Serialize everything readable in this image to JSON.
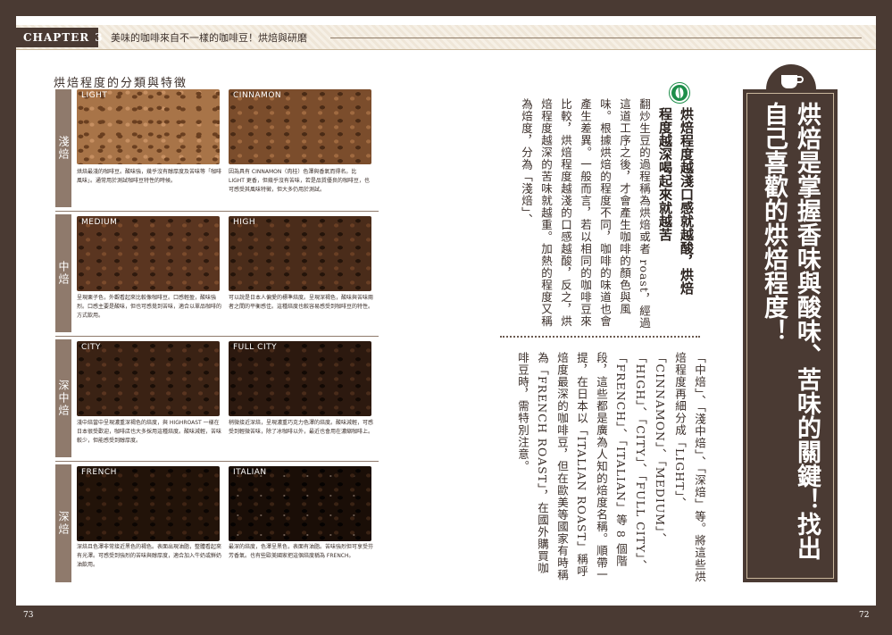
{
  "header": {
    "chapter_label": "CHAPTER",
    "chapter_number": "3",
    "chapter_title": "美味的咖啡來自不一樣的咖啡豆！烘焙與研磨"
  },
  "left_page": {
    "section_title": "烘焙程度的分類與特徵",
    "groups": [
      {
        "label": "淺焙"
      },
      {
        "label": "中焙"
      },
      {
        "label": "深中焙"
      },
      {
        "label": "深焙"
      }
    ],
    "roasts": [
      {
        "name": "LIGHT",
        "description": "烘焙最淺的咖啡豆。酸味強，幾乎沒有醇厚度及苦味等「咖啡風味」。通常用於測試咖啡豆特性的時候。"
      },
      {
        "name": "CINNAMON",
        "description": "因為具有 CINNAMON（肉桂）色澤與香氣而得名。比 LIGHT 更香，但幾乎沒有苦味，若是品質優良的咖啡豆，也可感受其風味特徵，但大多仍用於測試。"
      },
      {
        "name": "MEDIUM",
        "description": "呈現栗子色，外觀看起來比較像咖啡豆。口感輕盈，酸味強烈。口感主要是酸味，但也可感覺到苦味，適合以單品咖啡的方式飲用。"
      },
      {
        "name": "HIGH",
        "description": "可以說是日本人偏愛的標準焙度。呈現深褐色，酸味與苦味兩者之間的平衡感佳。這種焙度也較容易感受到咖啡豆的特性。"
      },
      {
        "name": "CITY",
        "description": "淺中焙當中呈現濃重深褐色的焙度，與 HIGHROAST 一樣在日本很受歡迎，咖啡店也大多採用這種焙度。酸味減輕，苦味較少，但能感受到醇厚度。"
      },
      {
        "name": "FULL CITY",
        "description": "稍微接近深焙，呈現濃重巧克力色澤的焙度。酸味減輕，可感受到輕微苦味，除了冰咖啡以外，最近也會用在濃縮咖啡上。"
      },
      {
        "name": "FRENCH",
        "description": "深焙且色澤非常接近黑色的褐色。表面出現油脂，整體看起來有光澤。可感受到強烈的苦味與醇厚度，適合加入牛奶或鮮奶油飲用。"
      },
      {
        "name": "ITALIAN",
        "description": "最深的焙度，色澤呈黑色，表面有油脂。苦味強烈但可享受芬芳香氣。也有些歐美國家把這個焙度稱為 FRENCH。"
      }
    ],
    "page_number": "73"
  },
  "right_page": {
    "main_title": "烘焙是掌握香味與酸味、苦味的關鍵！找出自己喜歡的烘焙程度！",
    "sub_title": "烘焙程度越淺口感就越酸，烘焙程度越深喝起來就越苦",
    "paragraph_1": "翻炒生豆的過程稱為烘焙或者 roast，經過這道工序之後，才會產生咖啡的顏色與風味。根據烘焙的程度不同，咖啡的味道也會產生差異。一般而言，若以相同的咖啡豆來比較，烘焙程度越淺的口感越酸，反之，烘焙程度越深的苦味就越重。加熱的程度又稱為焙度，分為「淺焙」、",
    "paragraph_2": "「中焙」、「淺中焙」、「深焙」等。將這些烘焙程度再細分成「LIGHT」、「CINNAMON」、「MEDIUM」、「HIGH」、「CITY」、「FULL CITY」、「FRENCH」、「ITALIAN」等 8 個階段，這些都是廣為人知的焙度名稱。順帶一提，在日本以「ITALIAN ROAST」稱呼焙度最深的咖啡豆，但在歐美等國家有時稱為「FRENCH ROAST」，在國外購買咖啡豆時，需特別注意。",
    "page_number": "72"
  },
  "colors": {
    "frame": "#4a3a33",
    "side_tab": "#8f7a6c",
    "accent_green": "#1e8e4a"
  }
}
